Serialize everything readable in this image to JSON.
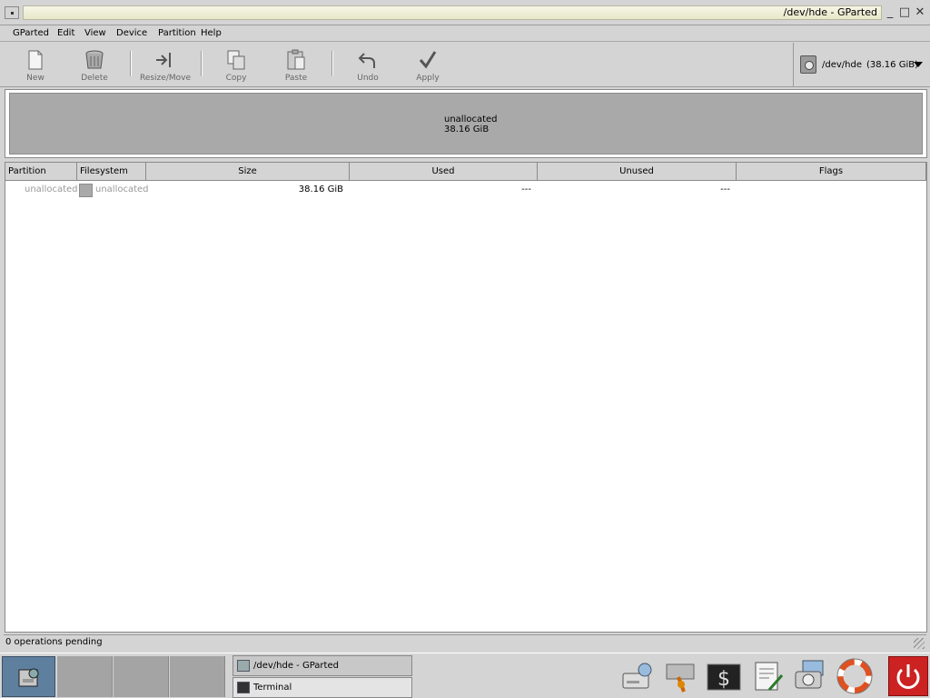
{
  "window": {
    "title": "/dev/hde - GParted"
  },
  "menu": [
    "GParted",
    "Edit",
    "View",
    "Device",
    "Partition",
    "Help"
  ],
  "toolbar": {
    "new": "New",
    "delete": "Delete",
    "resize": "Resize/Move",
    "copy": "Copy",
    "paste": "Paste",
    "undo": "Undo",
    "apply": "Apply"
  },
  "device": {
    "name": "/dev/hde",
    "size": "(38.16 GiB)"
  },
  "visual": {
    "label": "unallocated",
    "size": "38.16 GiB"
  },
  "table": {
    "headers": [
      "Partition",
      "Filesystem",
      "Size",
      "Used",
      "Unused",
      "Flags"
    ],
    "rows": [
      {
        "partition": "unallocated",
        "filesystem": "unallocated",
        "size": "38.16 GiB",
        "used": "---",
        "unused": "---",
        "flags": ""
      }
    ]
  },
  "status": "0 operations pending",
  "taskbar": {
    "tasks": [
      "/dev/hde - GParted",
      "Terminal"
    ]
  },
  "colors": {
    "unallocated": "#a9a9a9",
    "start_button": "#5f7f9f",
    "shutdown": "#cc2222"
  }
}
